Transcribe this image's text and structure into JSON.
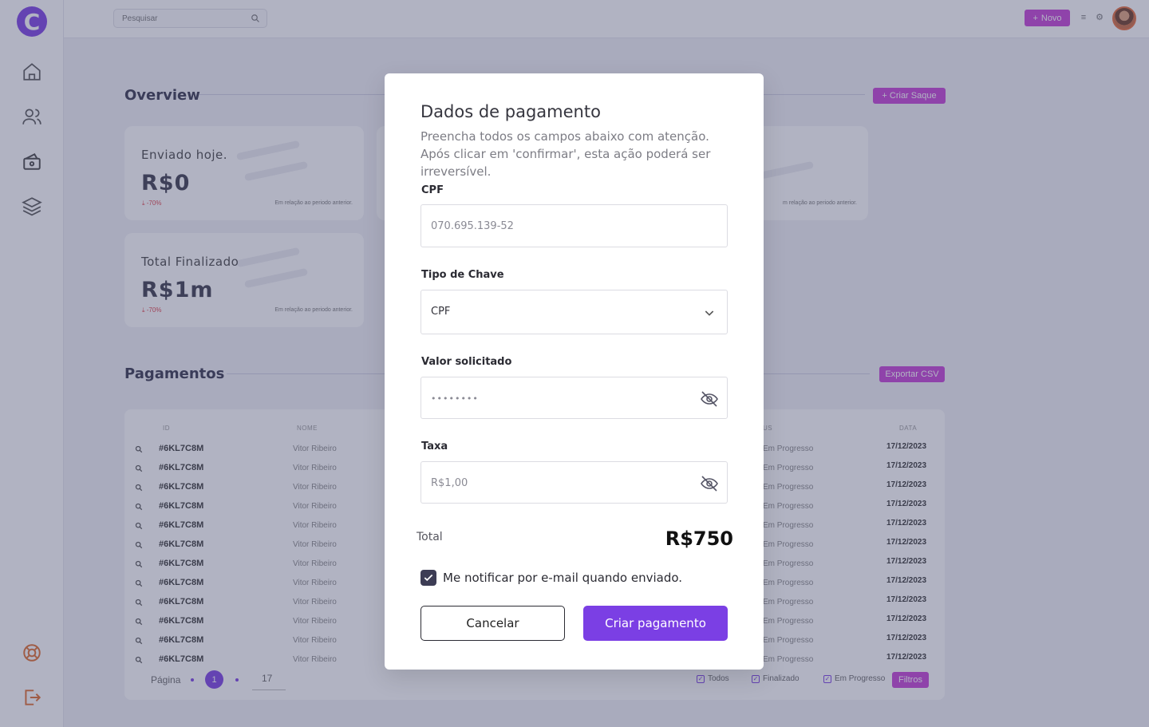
{
  "colors": {
    "brand_purple": "#7b3fe4",
    "accent_pink": "#c43fd6",
    "negative_red": "#e0424b"
  },
  "app": {
    "logo_letter": "C"
  },
  "sidebar": {
    "items": [
      {
        "name": "home-icon"
      },
      {
        "name": "users-icon"
      },
      {
        "name": "wallet-icon"
      },
      {
        "name": "layers-icon"
      }
    ],
    "bottom": [
      {
        "name": "support-icon"
      },
      {
        "name": "logout-icon"
      }
    ]
  },
  "topbar": {
    "search_placeholder": "Pesquisar",
    "new_label": "Novo"
  },
  "overview": {
    "title": "Overview",
    "create_withdraw_label": "Criar Saque",
    "cards": [
      {
        "label": "Enviado hoje.",
        "value": "R$0",
        "delta": "-70%",
        "note": "Em relação ao periodo  anterior."
      },
      {
        "label": "Total Finalizado",
        "value": "R$1m",
        "delta": "-70%",
        "note": "Em relação ao periodo  anterior."
      },
      {
        "note": "m relação ao periodo  anterior."
      }
    ]
  },
  "payments": {
    "title": "Pagamentos",
    "export_label": "Exportar CSV",
    "columns": {
      "id": "ID",
      "name": "NOME",
      "status": "US",
      "date": "DATA"
    },
    "rows": [
      {
        "id": "#6KL7C8M",
        "name": "Vitor Ribeiro",
        "status": "Em Progresso",
        "date": "17/12/2023"
      },
      {
        "id": "#6KL7C8M",
        "name": "Vitor Ribeiro",
        "status": "Em Progresso",
        "date": "17/12/2023"
      },
      {
        "id": "#6KL7C8M",
        "name": "Vitor Ribeiro",
        "status": "Em Progresso",
        "date": "17/12/2023"
      },
      {
        "id": "#6KL7C8M",
        "name": "Vitor Ribeiro",
        "status": "Em Progresso",
        "date": "17/12/2023"
      },
      {
        "id": "#6KL7C8M",
        "name": "Vitor Ribeiro",
        "status": "Em Progresso",
        "date": "17/12/2023"
      },
      {
        "id": "#6KL7C8M",
        "name": "Vitor Ribeiro",
        "status": "Em Progresso",
        "date": "17/12/2023"
      },
      {
        "id": "#6KL7C8M",
        "name": "Vitor Ribeiro",
        "status": "Em Progresso",
        "date": "17/12/2023"
      },
      {
        "id": "#6KL7C8M",
        "name": "Vitor Ribeiro",
        "status": "Em Progresso",
        "date": "17/12/2023"
      },
      {
        "id": "#6KL7C8M",
        "name": "Vitor Ribeiro",
        "status": "Em Progresso",
        "date": "17/12/2023"
      },
      {
        "id": "#6KL7C8M",
        "name": "Vitor Ribeiro",
        "status": "Em Progresso",
        "date": "17/12/2023"
      },
      {
        "id": "#6KL7C8M",
        "name": "Vitor Ribeiro",
        "status": "Em Progresso",
        "date": "17/12/2023"
      },
      {
        "id": "#6KL7C8M",
        "name": "Vitor Ribeiro",
        "status": "Em Progresso",
        "date": "17/12/2023"
      }
    ],
    "pager": {
      "label": "Página",
      "current_page": "1",
      "page_size": "17"
    },
    "filters": {
      "all": "Todos",
      "finished": "Finalizado",
      "in_progress": "Em Progresso",
      "button": "Filtros"
    }
  },
  "modal": {
    "title": "Dados de pagamento",
    "description": "Preencha todos os campos abaixo com atenção. Após clicar em 'confirmar', esta ação poderá ser irreversível.",
    "cpf": {
      "label": "CPF",
      "placeholder": "070.695.139-52"
    },
    "key_type": {
      "label": "Tipo de Chave",
      "value": "CPF"
    },
    "amount": {
      "label": "Valor solicitado",
      "value": "••••••••"
    },
    "fee": {
      "label": "Taxa",
      "placeholder": "R$1,00"
    },
    "total": {
      "label": "Total",
      "value": "R$750"
    },
    "notify": {
      "label": "Me notificar por e-mail quando enviado.",
      "checked": true
    },
    "cancel_label": "Cancelar",
    "create_label": "Criar pagamento"
  }
}
